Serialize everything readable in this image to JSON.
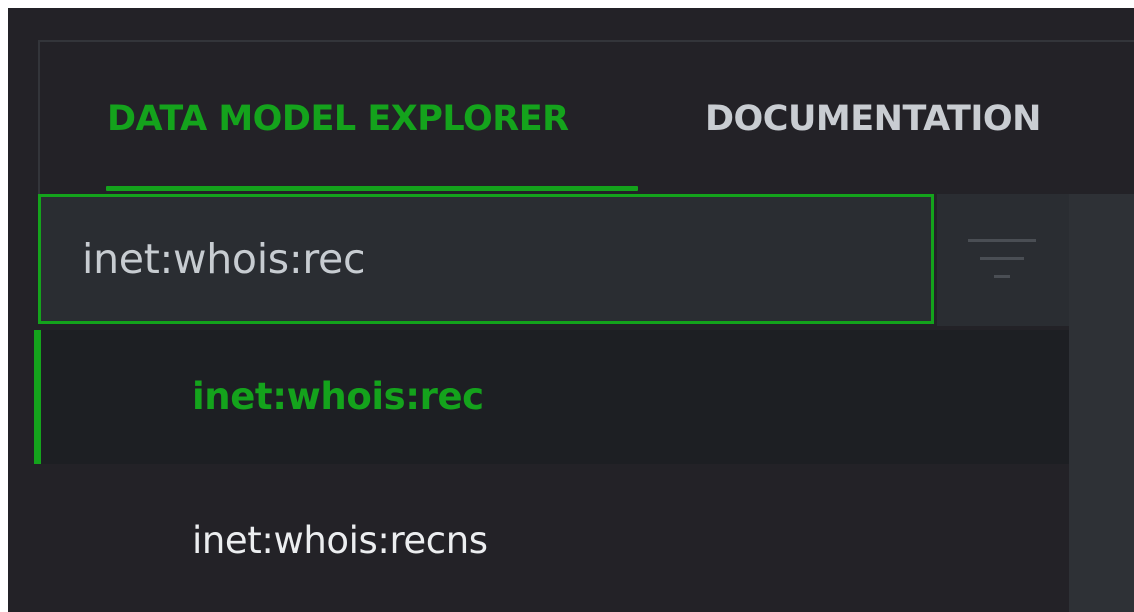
{
  "colors": {
    "accent": "#14a31c",
    "background": "#232227",
    "input_background": "#2a2d32",
    "selected_row_background": "#1d1f23",
    "inactive_tab_text": "#c9cdd2",
    "item_text": "#eceef0"
  },
  "tabs": [
    {
      "label": "DATA MODEL EXPLORER",
      "active": true
    },
    {
      "label": "DOCUMENTATION",
      "active": false
    }
  ],
  "search": {
    "value": "inet:whois:rec"
  },
  "filter_button": {
    "icon": "filter-icon"
  },
  "results": [
    {
      "label": "inet:whois:rec",
      "selected": true
    },
    {
      "label": "inet:whois:recns",
      "selected": false
    }
  ]
}
